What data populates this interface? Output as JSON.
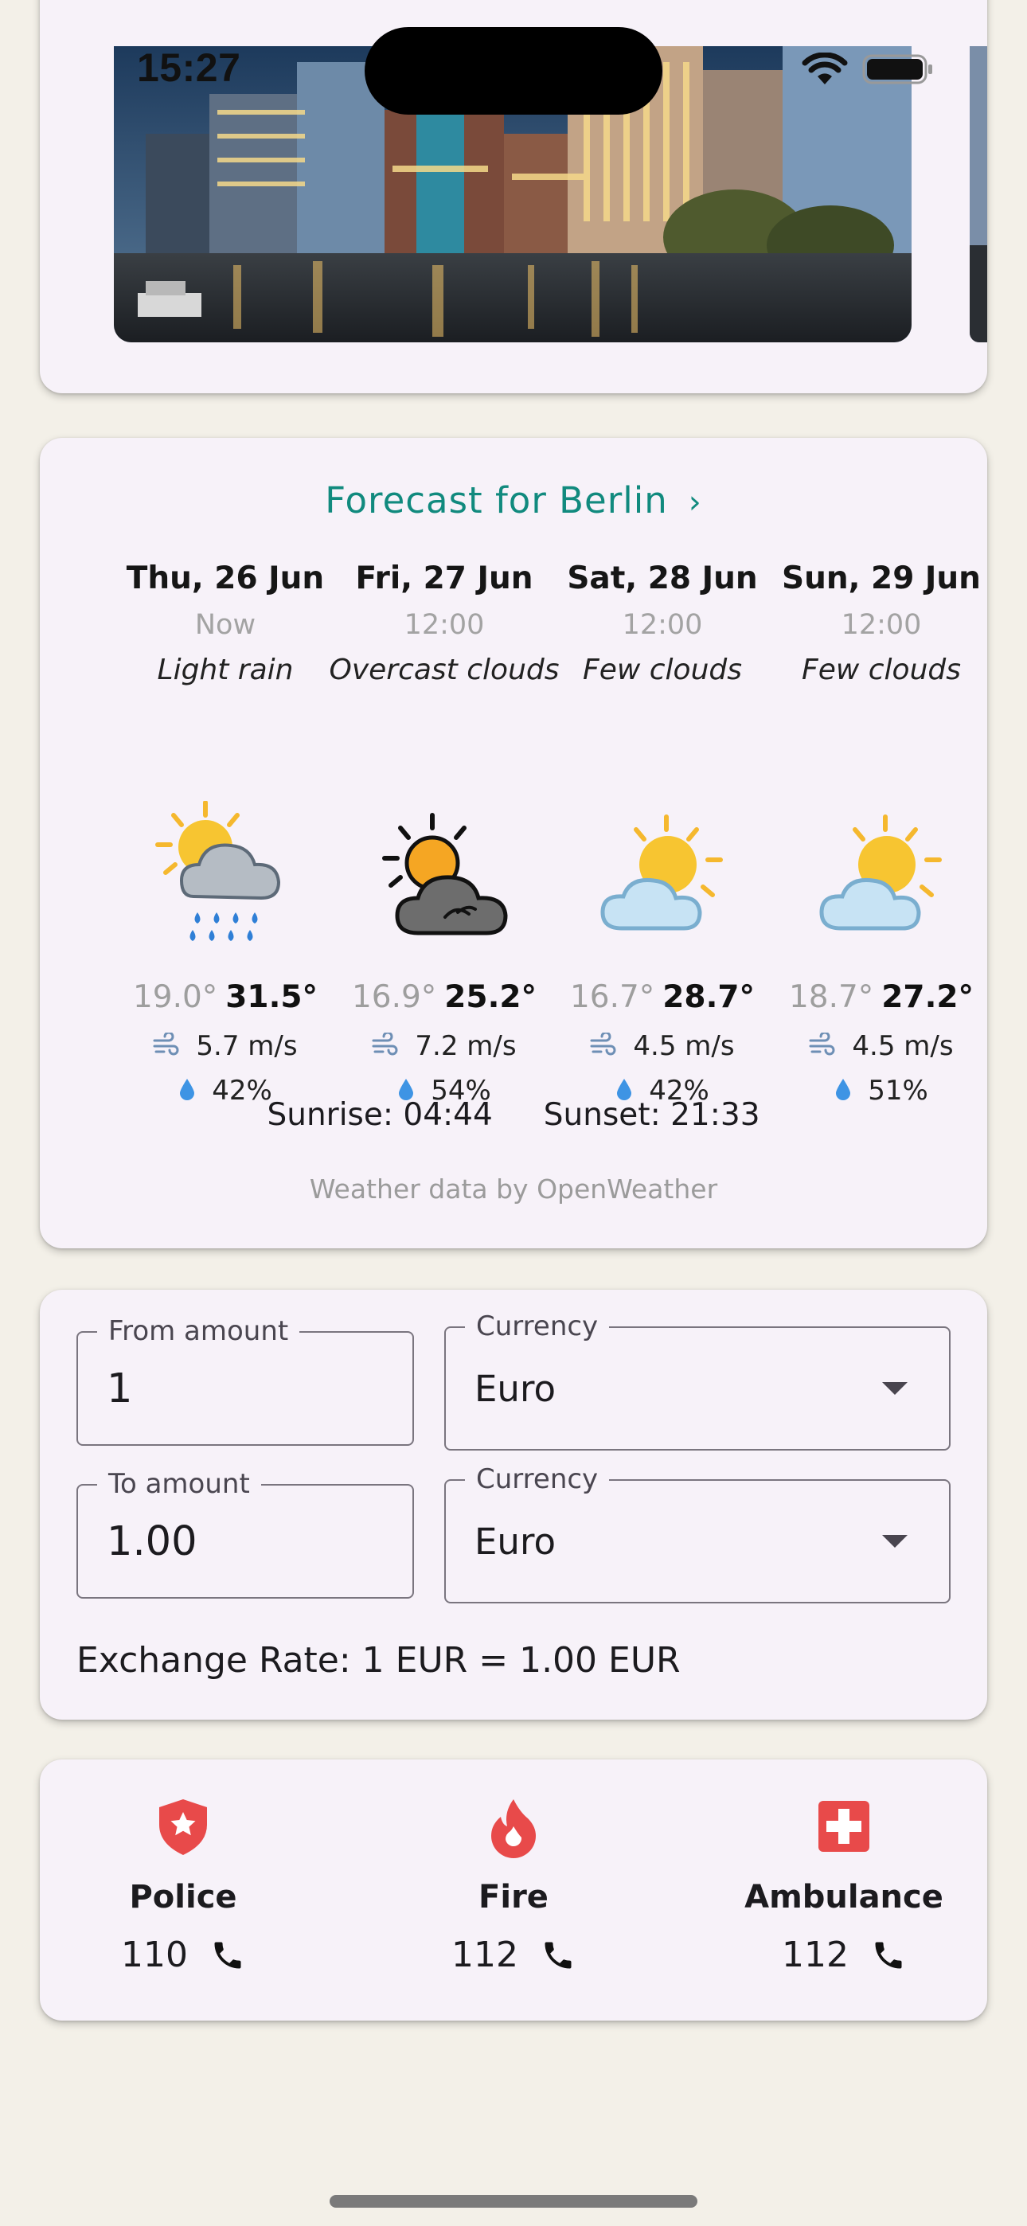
{
  "status_bar": {
    "time": "15:27"
  },
  "forecast": {
    "title": "Forecast for Berlin",
    "days": [
      {
        "name": "Thu, 26 Jun",
        "time": "Now",
        "description": "Light rain",
        "min": "19.0°",
        "max": "31.5°",
        "wind": "5.7 m/s",
        "humidity": "42%",
        "icon": "sun-cloud-rain-icon"
      },
      {
        "name": "Fri, 27 Jun",
        "time": "12:00",
        "description": "Overcast clouds",
        "min": "16.9°",
        "max": "25.2°",
        "wind": "7.2 m/s",
        "humidity": "54%",
        "icon": "sun-behind-dark-cloud-icon"
      },
      {
        "name": "Sat, 28 Jun",
        "time": "12:00",
        "description": "Few clouds",
        "min": "16.7°",
        "max": "28.7°",
        "wind": "4.5 m/s",
        "humidity": "42%",
        "icon": "sun-behind-cloud-icon"
      },
      {
        "name": "Sun, 29 Jun",
        "time": "12:00",
        "description": "Few clouds",
        "min": "18.7°",
        "max": "27.2°",
        "wind": "4.5 m/s",
        "humidity": "51%",
        "icon": "sun-behind-cloud-icon"
      }
    ],
    "sunrise": "Sunrise: 04:44",
    "sunset": "Sunset: 21:33",
    "attribution": "Weather data by OpenWeather"
  },
  "currency": {
    "from_label": "From amount",
    "from_value": "1",
    "from_currency_label": "Currency",
    "from_currency": "Euro",
    "to_label": "To amount",
    "to_value": "1.00",
    "to_currency_label": "Currency",
    "to_currency": "Euro",
    "rate_text": "Exchange Rate: 1 EUR = 1.00 EUR"
  },
  "emergency": [
    {
      "label": "Police",
      "number": "110",
      "icon": "police-shield-icon"
    },
    {
      "label": "Fire",
      "number": "112",
      "icon": "fire-icon"
    },
    {
      "label": "Ambulance",
      "number": "112",
      "icon": "ambulance-cross-icon"
    }
  ],
  "colors": {
    "accent": "#118a7e",
    "emergency_red": "#e84a4a",
    "card_bg": "#f7f2f9",
    "page_bg": "#f3f0e8"
  }
}
